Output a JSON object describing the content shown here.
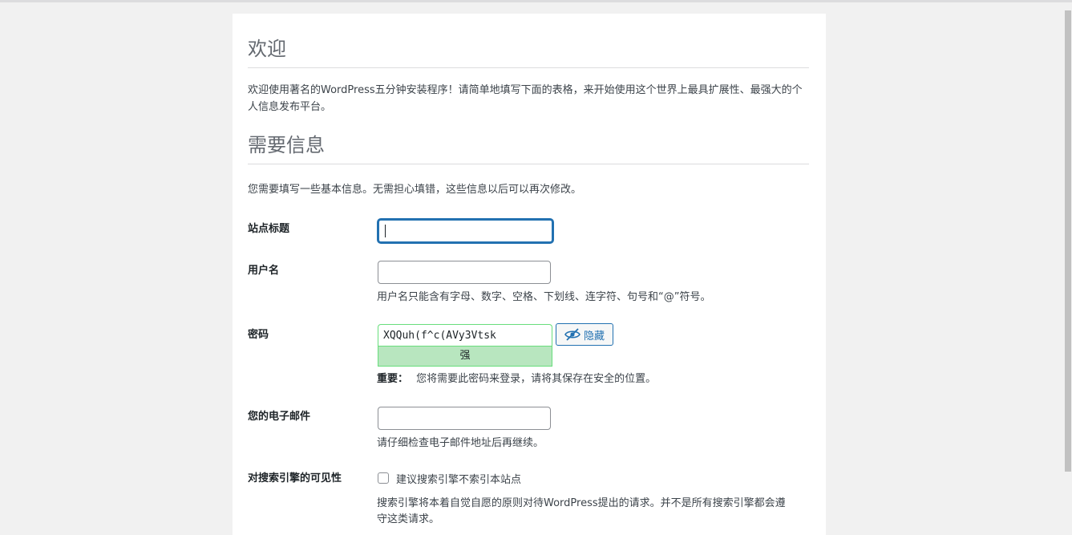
{
  "welcome": {
    "heading": "欢迎",
    "text": "欢迎使用著名的WordPress五分钟安装程序！请简单地填写下面的表格，来开始使用这个世界上最具扩展性、最强大的个人信息发布平台。"
  },
  "info": {
    "heading": "需要信息",
    "text": "您需要填写一些基本信息。无需担心填错，这些信息以后可以再次修改。"
  },
  "fields": {
    "site_title_label": "站点标题",
    "username_label": "用户名",
    "username_desc": "用户名只能含有字母、数字、空格、下划线、连字符、句号和“@”符号。",
    "password_label": "密码",
    "password_value": "XQQuh(f^c(AVy3Vtsk",
    "password_strength": "强",
    "hide_button": "隐藏",
    "password_important": "重要：",
    "password_note": "您将需要此密码来登录，请将其保存在安全的位置。",
    "email_label": "您的电子邮件",
    "email_desc": "请仔细检查电子邮件地址后再继续。",
    "visibility_label": "对搜索引擎的可见性",
    "visibility_checkbox": "建议搜索引擎不索引本站点",
    "visibility_desc": "搜索引擎将本着自觉自愿的原则对待WordPress提出的请求。并不是所有搜索引擎都会遵守这类请求。"
  },
  "colors": {
    "accent": "#2271b1",
    "strong_bg": "#b8e6bf",
    "strong_border": "#68de7c"
  },
  "icons": {
    "hide": "eye-slash-icon"
  }
}
